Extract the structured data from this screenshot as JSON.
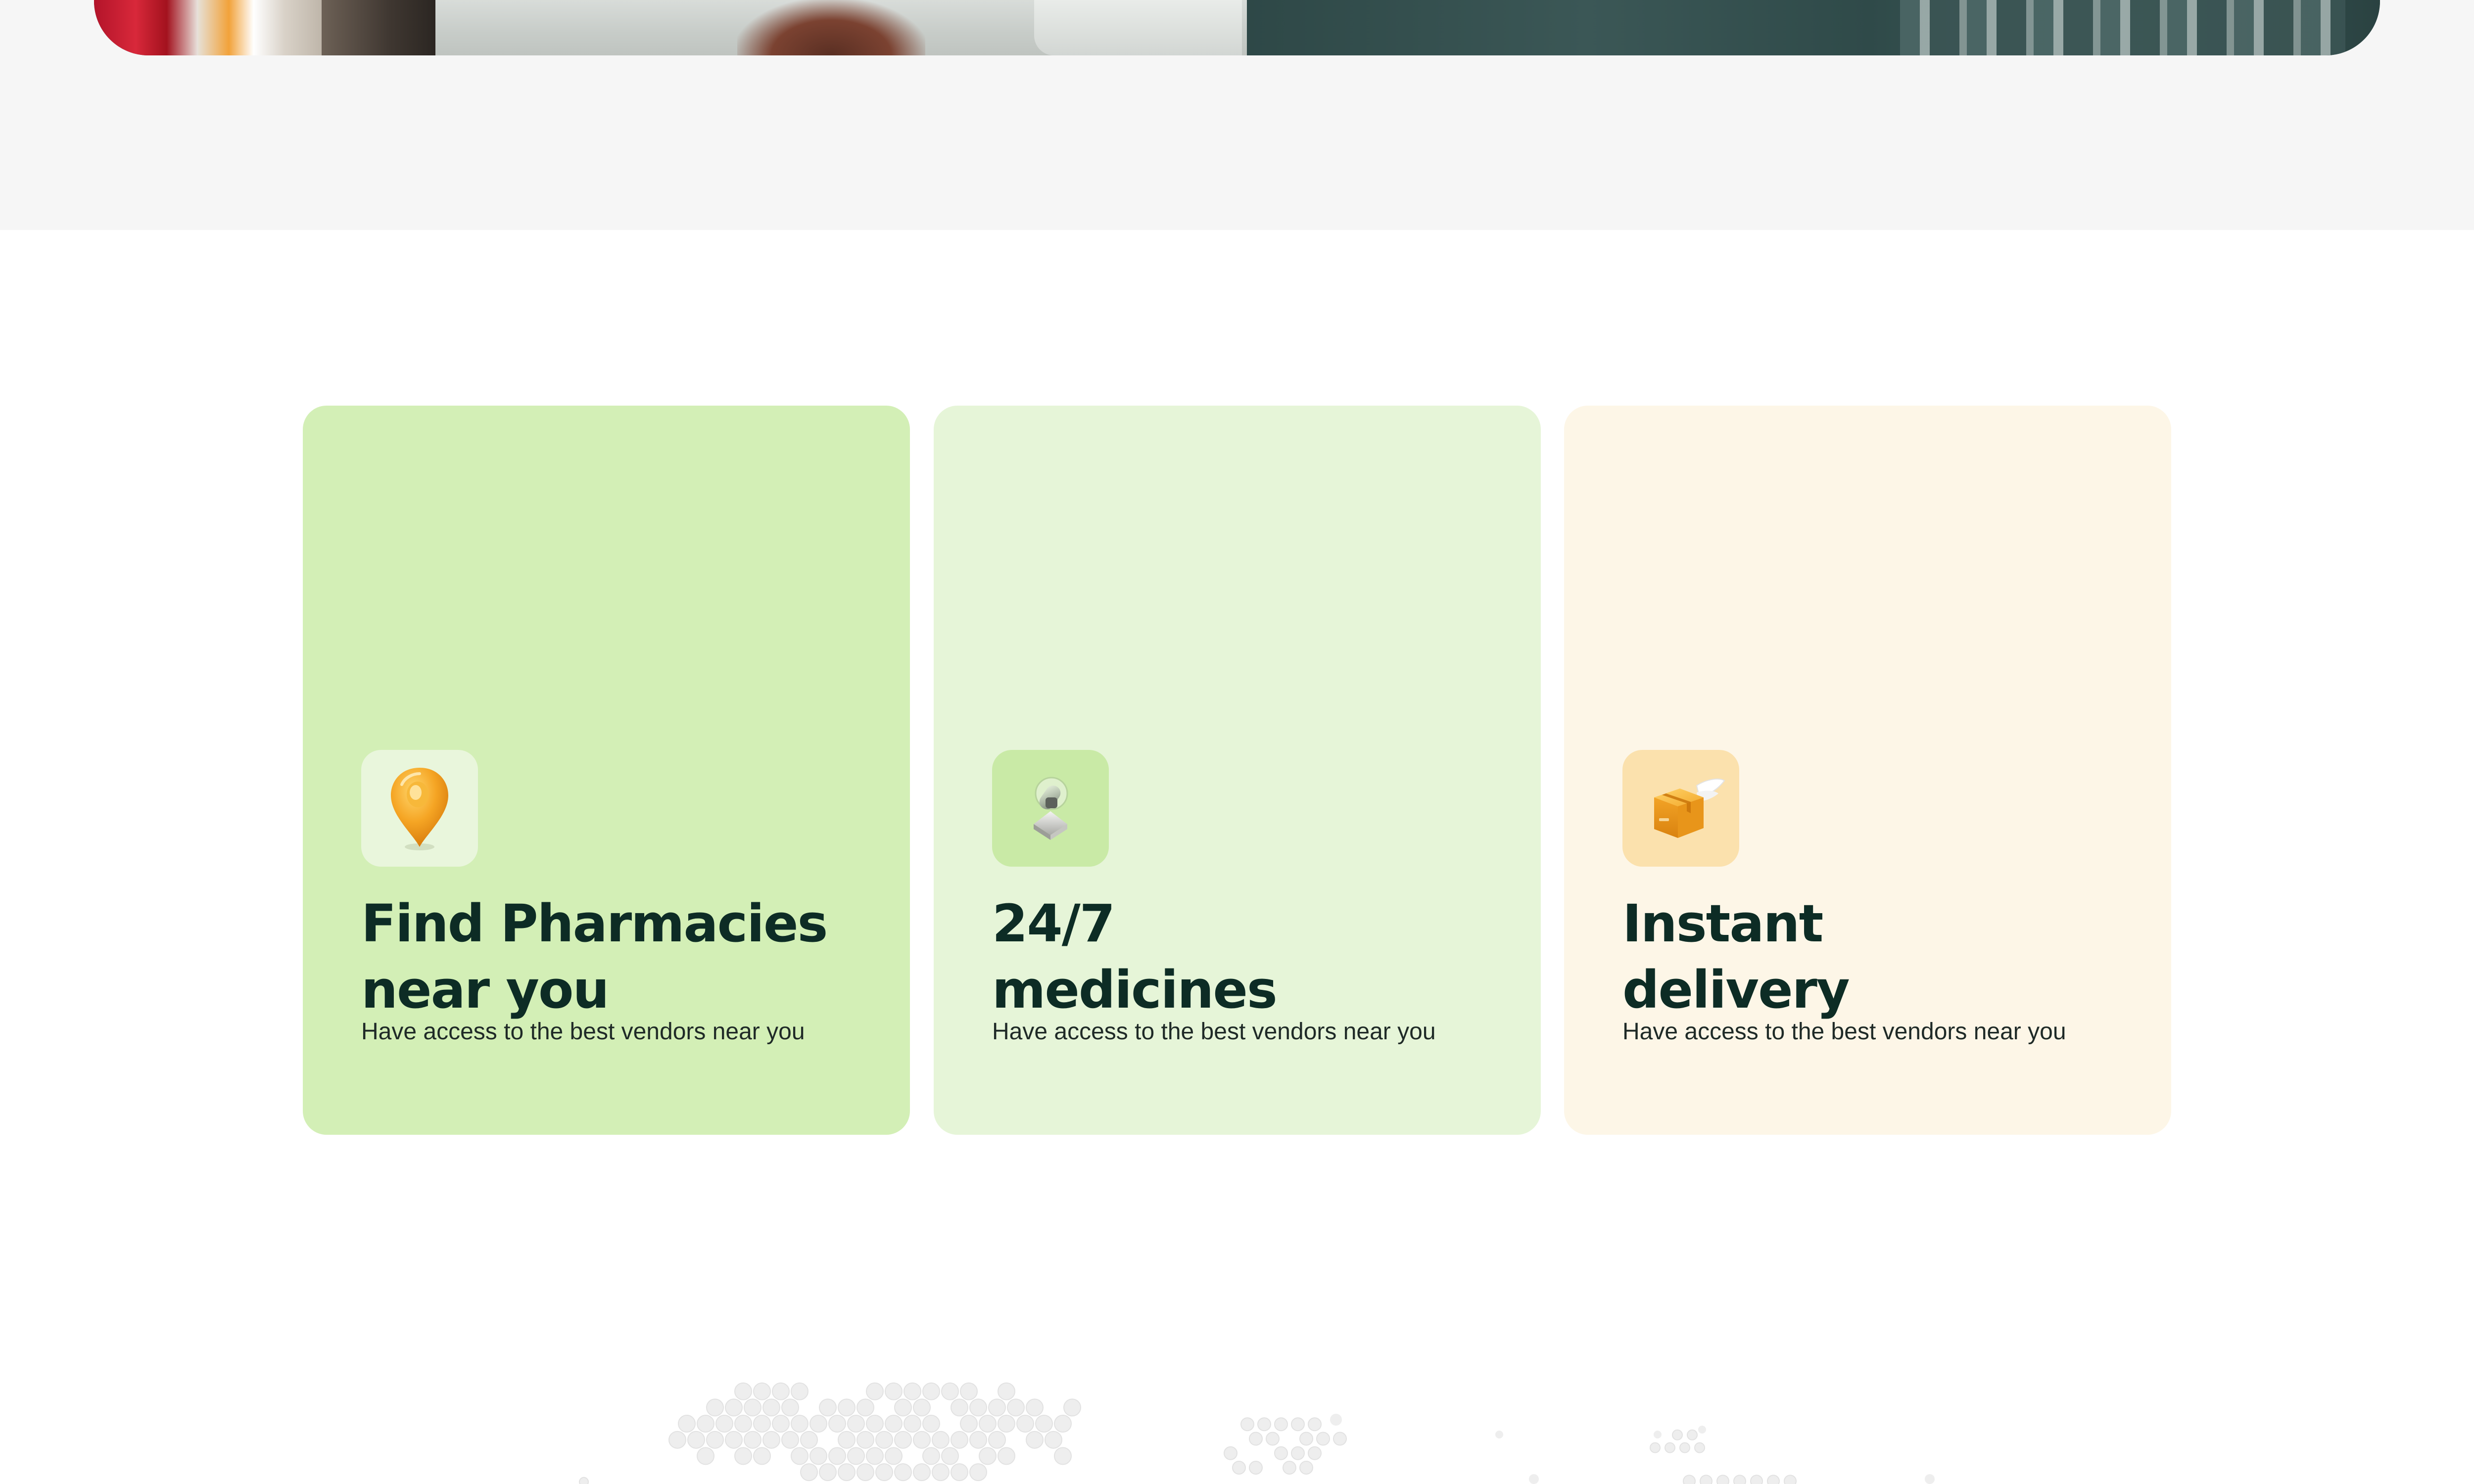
{
  "colors": {
    "card_1_bg": "#d3efb6",
    "card_2_bg": "#e6f5d8",
    "card_3_bg": "#fdf6e7",
    "title_color": "#0d2c25",
    "text_color": "#1f2a27",
    "top_band_bg": "#f6f6f6"
  },
  "hero": {
    "image_icon": "pharmacist-photo"
  },
  "features": [
    {
      "icon": "location-pin-icon",
      "title_line_1": "Find Pharmacies",
      "title_line_2": "near you",
      "description": "Have access to the best vendors near you"
    },
    {
      "icon": "medicine-icon",
      "title_line_1": "24/7",
      "title_line_2": "medicines",
      "description": "Have access to the best vendors near you"
    },
    {
      "icon": "delivery-box-icon",
      "title_line_1": "Instant",
      "title_line_2": "delivery",
      "description": "Have access to the best vendors near you"
    }
  ],
  "decoration": {
    "icon": "dotted-world-map"
  }
}
